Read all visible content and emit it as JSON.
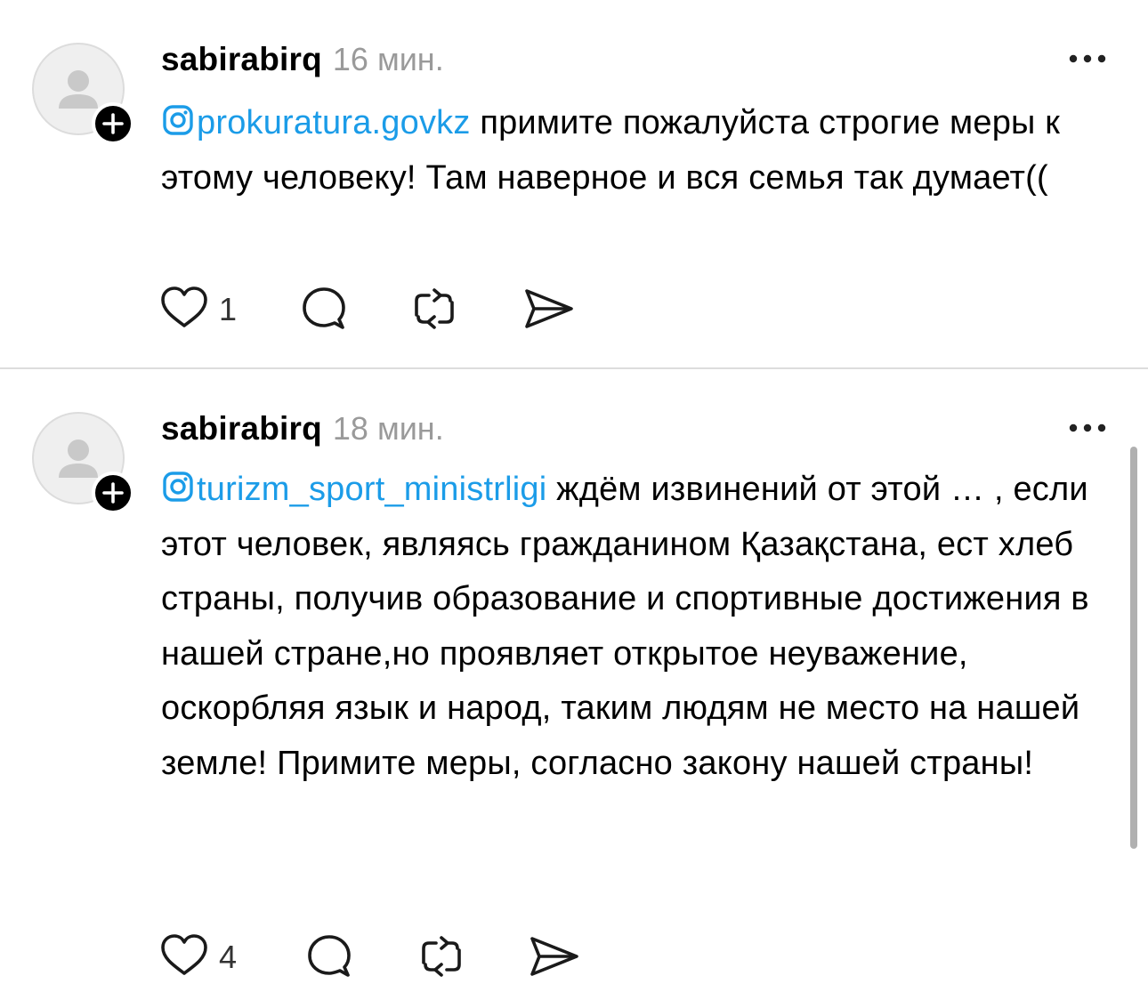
{
  "posts": [
    {
      "username": "sabirabirq",
      "time": "16 мин.",
      "mention": "prokuratura.govkz",
      "text": " примите пожалуйста строгие меры к этому человеку! Там наверное и вся семья так думает((",
      "likes": "1",
      "icons": {
        "avatar": "default-avatar-icon",
        "follow": "plus-icon",
        "more": "more-dots-icon",
        "mention": "instagram-icon",
        "like": "heart-icon",
        "reply": "comment-bubble-icon",
        "repost": "repost-icon",
        "share": "send-icon"
      }
    },
    {
      "username": "sabirabirq",
      "time": "18 мин.",
      "mention": "turizm_sport_ministrligi",
      "text": " ждём извинений от этой … , если этот человек, являясь гражданином Қазақстана, ест хлеб страны, получив образование и спортивные достижения в нашей стране,но  проявляет открытое неуважение, оскорбляя язык и народ, таким людям не место на нашей земле! Примите меры, согласно закону нашей страны!",
      "likes": "4",
      "icons": {
        "avatar": "default-avatar-icon",
        "follow": "plus-icon",
        "more": "more-dots-icon",
        "mention": "instagram-icon",
        "like": "heart-icon",
        "reply": "comment-bubble-icon",
        "repost": "repost-icon",
        "share": "send-icon"
      }
    }
  ],
  "colors": {
    "mention": "#1b9ce8",
    "time": "#9a9a9a",
    "divider": "#dddddd",
    "text": "#000000"
  }
}
